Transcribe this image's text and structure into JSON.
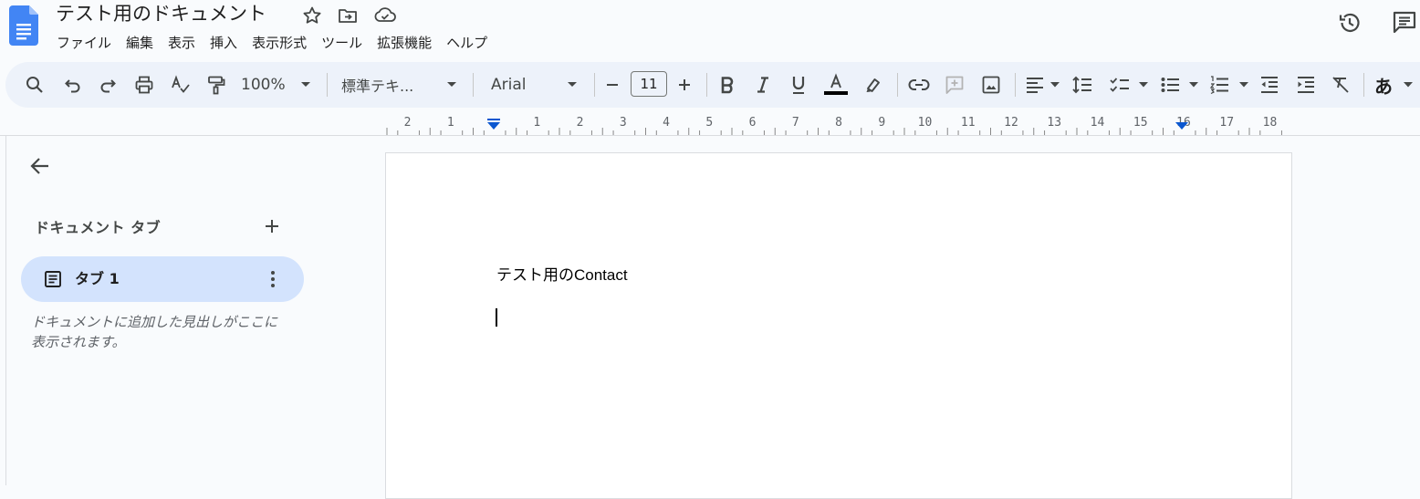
{
  "document": {
    "title": "テスト用のドキュメント"
  },
  "menu": [
    "ファイル",
    "編集",
    "表示",
    "挿入",
    "表示形式",
    "ツール",
    "拡張機能",
    "ヘルプ"
  ],
  "toolbar": {
    "zoom": "100%",
    "style": "標準テキ...",
    "font": "Arial",
    "font_size": "11",
    "input_mode": "あ"
  },
  "ruler": {
    "labels": [
      "2",
      "1",
      "1",
      "2",
      "3",
      "4",
      "5",
      "6",
      "7",
      "8",
      "9",
      "10",
      "11",
      "12",
      "13",
      "14",
      "15",
      "16",
      "17",
      "18"
    ]
  },
  "sidebar": {
    "heading": "ドキュメント タブ",
    "tabs": [
      {
        "label": "タブ 1"
      }
    ],
    "hint": "ドキュメントに追加した見出しがここに表示されます。"
  },
  "page": {
    "body_text": "テスト用のContact"
  },
  "colors": {
    "accent": "#0b57d0",
    "tab_bg": "#d3e3fd",
    "toolbar_bg": "#edf2fa",
    "doc_blue": "#4285f4"
  }
}
